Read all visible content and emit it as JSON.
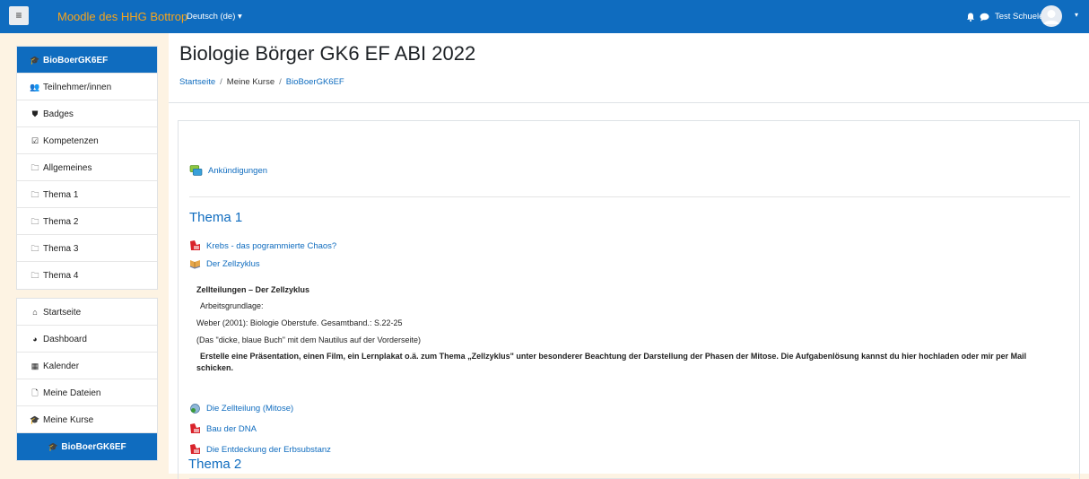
{
  "navbar": {
    "menu_icon": "hamburger-icon",
    "site_name": "Moodle des HHG Bottrop",
    "language": "Deutsch (de)",
    "user_name": "Test Schueler",
    "colors": {
      "bar": "#0f6cbf",
      "brand": "#f7a41b"
    }
  },
  "drawer": {
    "course_items": [
      {
        "label": "BioBoerGK6EF",
        "icon": "graduation-cap-icon",
        "active": true
      },
      {
        "label": "Teilnehmer/innen",
        "icon": "users-icon"
      },
      {
        "label": "Badges",
        "icon": "shield-icon"
      },
      {
        "label": "Kompetenzen",
        "icon": "checkbox-icon"
      },
      {
        "label": "Allgemeines",
        "icon": "folder-icon"
      },
      {
        "label": "Thema 1",
        "icon": "folder-icon"
      },
      {
        "label": "Thema 2",
        "icon": "folder-icon"
      },
      {
        "label": "Thema 3",
        "icon": "folder-icon"
      },
      {
        "label": "Thema 4",
        "icon": "folder-icon"
      }
    ],
    "site_items": [
      {
        "label": "Startseite",
        "icon": "home-icon"
      },
      {
        "label": "Dashboard",
        "icon": "dashboard-icon"
      },
      {
        "label": "Kalender",
        "icon": "calendar-icon"
      },
      {
        "label": "Meine Dateien",
        "icon": "file-icon"
      },
      {
        "label": "Meine Kurse",
        "icon": "graduation-cap-icon"
      },
      {
        "label": "BioBoerGK6EF",
        "icon": "graduation-cap-icon",
        "active": true
      }
    ]
  },
  "main": {
    "title": "Biologie Börger GK6 EF ABI 2022",
    "breadcrumb": [
      "Startseite",
      "Meine Kurse",
      "BioBoerGK6EF"
    ],
    "announcements": "Ankündigungen",
    "section1": {
      "title": "Thema 1",
      "activities_top": [
        {
          "label": "Krebs - das pogrammierte Chaos?",
          "icon": "pdf-icon"
        },
        {
          "label": "Der Zellzyklus",
          "icon": "book-icon"
        }
      ],
      "summary_heading": "Zellteilungen – Der Zellzyklus",
      "summary_lines": [
        "Arbeitsgrundlage:",
        "Weber (2001): Biologie Oberstufe. Gesamtband.: S.22-25",
        "(Das \"dicke, blaue Buch\" mit dem Nautilus auf der Vorderseite)"
      ],
      "task": "Erstelle eine Präsentation, einen Film, ein Lernplakat o.ä. zum Thema „Zellzyklus\" unter besonderer Beachtung der Darstellung der Phasen der Mitose. Die Aufgabenlösung kannst du hier hochladen oder mir per Mail schicken.",
      "activities_bottom": [
        {
          "label": "Die Zellteilung (Mitose)",
          "icon": "assignment-icon"
        },
        {
          "label": "Bau der DNA",
          "icon": "pdf-icon"
        },
        {
          "label": "Die Entdeckung der Erbsubstanz",
          "icon": "pdf-icon"
        }
      ]
    },
    "section2": {
      "title": "Thema 2"
    }
  }
}
